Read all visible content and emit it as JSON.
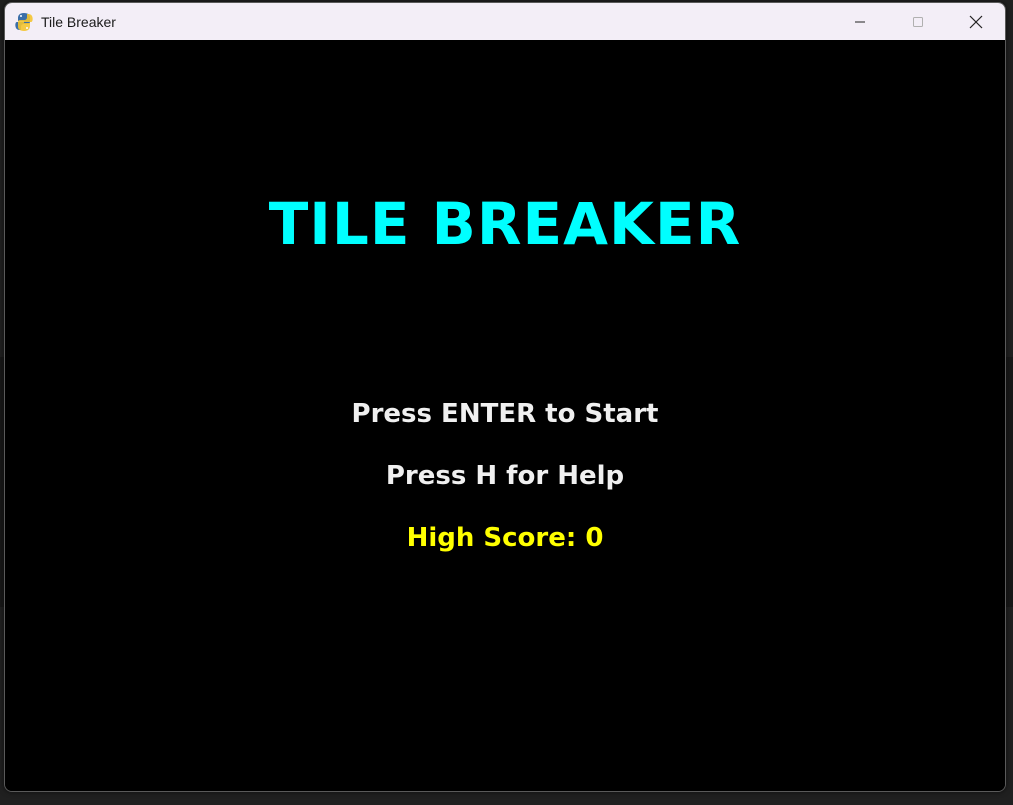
{
  "window": {
    "title": "Tile Breaker",
    "app_icon": "pygame-snake-icon",
    "controls": {
      "minimize_icon": "minimize-icon",
      "maximize_icon": "maximize-icon",
      "close_icon": "close-icon"
    }
  },
  "game": {
    "title": "TILE BREAKER",
    "start_prompt": "Press ENTER to Start",
    "help_prompt": "Press H for Help",
    "high_score_label": "High Score: 0"
  },
  "colors": {
    "background": "#000000",
    "title": "#00ffff",
    "menu_text": "#f0f0f0",
    "high_score": "#ffff00",
    "titlebar": "#f3eef7"
  }
}
